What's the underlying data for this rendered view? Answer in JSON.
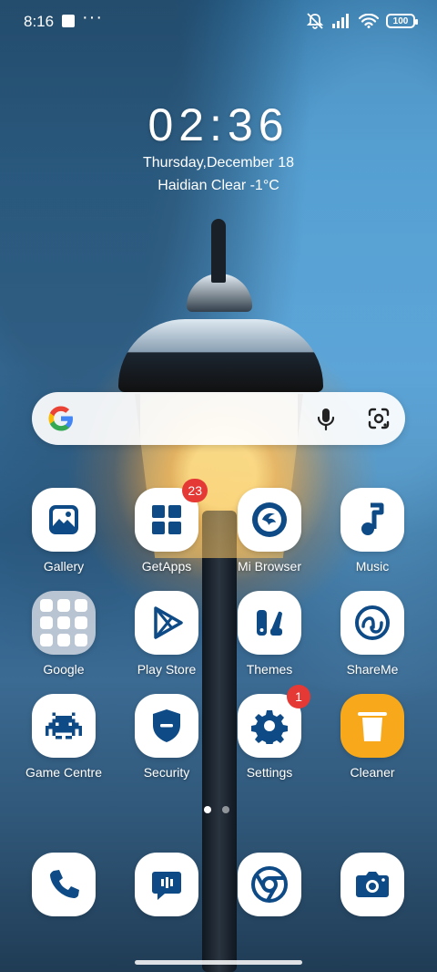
{
  "status_bar": {
    "time": "8:16",
    "battery": "100"
  },
  "clock": {
    "time": "02:36",
    "date": "Thursday,December 18",
    "weather": "Haidian Clear -1°C"
  },
  "search": {
    "logo": "G"
  },
  "apps": {
    "gallery": "Gallery",
    "getapps": "GetApps",
    "getapps_badge": "23",
    "mibrowser": "Mi Browser",
    "music": "Music",
    "google": "Google",
    "playstore": "Play Store",
    "themes": "Themes",
    "shareme": "ShareMe",
    "gamecentre": "Game Centre",
    "security": "Security",
    "settings": "Settings",
    "settings_badge": "1",
    "cleaner": "Cleaner"
  },
  "dock": [
    "phone-icon",
    "messages-icon",
    "chrome-icon",
    "camera-icon"
  ],
  "colors": {
    "icon_blue": "#0d4a86",
    "badge_red": "#e53935",
    "cleaner_yellow": "#f7a81b"
  }
}
